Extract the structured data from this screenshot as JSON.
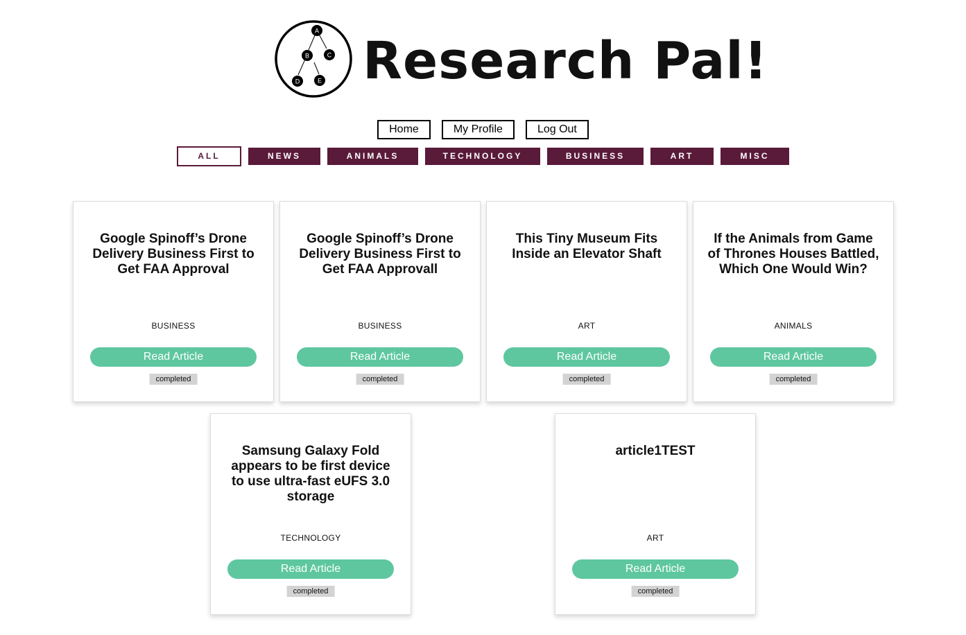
{
  "app": {
    "title": "Research Pal!",
    "logo_nodes": [
      "A",
      "B",
      "C",
      "D",
      "E"
    ]
  },
  "nav": {
    "home": "Home",
    "profile": "My Profile",
    "logout": "Log Out"
  },
  "categories": [
    {
      "label": "ALL",
      "active": true
    },
    {
      "label": "NEWS",
      "active": false
    },
    {
      "label": "ANIMALS",
      "active": false
    },
    {
      "label": "TECHNOLOGY",
      "active": false
    },
    {
      "label": "BUSINESS",
      "active": false
    },
    {
      "label": "ART",
      "active": false
    },
    {
      "label": "MISC",
      "active": false
    }
  ],
  "articles": [
    {
      "title": "Google Spinoff’s Drone Delivery Business First to Get FAA Approval",
      "category": "BUSINESS",
      "button": "Read Article",
      "status": "completed"
    },
    {
      "title": "Google Spinoff’s Drone Delivery Business First to Get FAA Approvall",
      "category": "BUSINESS",
      "button": "Read Article",
      "status": "completed"
    },
    {
      "title": "This Tiny Museum Fits Inside an Elevator Shaft",
      "category": "ART",
      "button": "Read Article",
      "status": "completed"
    },
    {
      "title": "If the Animals from Game of Thrones Houses Battled, Which One Would Win?",
      "category": "ANIMALS",
      "button": "Read Article",
      "status": "completed"
    },
    {
      "title": "Samsung Galaxy Fold appears to be first device to use ultra-fast eUFS 3.0 storage",
      "category": "TECHNOLOGY",
      "button": "Read Article",
      "status": "completed"
    },
    {
      "title": "article1TEST",
      "category": "ART",
      "button": "Read Article",
      "status": "completed"
    }
  ],
  "colors": {
    "category_bg": "#5a1a3a",
    "read_button": "#5ec7a0",
    "badge_bg": "#d3d3d3"
  }
}
